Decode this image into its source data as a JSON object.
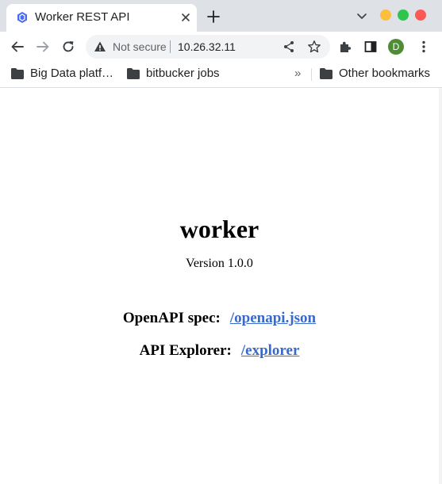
{
  "browser": {
    "tab": {
      "title": "Worker REST API",
      "favicon": "api-hexagon-icon"
    },
    "accent_colors": {
      "favicon": "#4b6cf0",
      "minimize": "#fdbe3e",
      "maximize": "#2ec54b",
      "close": "#fe5a55",
      "avatar": "#4e8c36",
      "link": "#3969c9"
    },
    "omnibox": {
      "security_label": "Not secure",
      "url": "10.26.32.11"
    },
    "profile": {
      "initial": "D"
    },
    "bookmarks": [
      {
        "label": "Big Data platf…",
        "icon": "folder-icon"
      },
      {
        "label": "bitbucker jobs",
        "icon": "folder-icon"
      }
    ],
    "bookmarks_overflow": "»",
    "other_bookmarks": {
      "label": "Other bookmarks",
      "icon": "folder-icon"
    }
  },
  "page": {
    "title": "worker",
    "version": "Version 1.0.0",
    "links": [
      {
        "label": "OpenAPI spec:",
        "href_text": "/openapi.json"
      },
      {
        "label": "API Explorer:",
        "href_text": "/explorer"
      }
    ]
  }
}
